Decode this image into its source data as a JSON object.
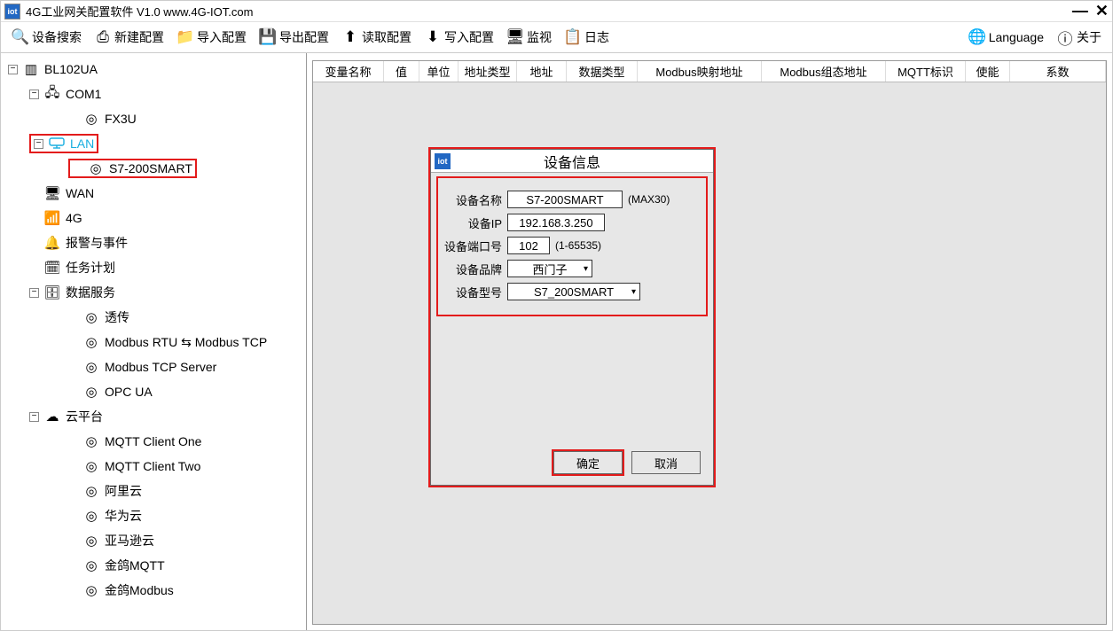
{
  "window": {
    "title": "4G工业网关配置软件 V1.0 www.4G-IOT.com"
  },
  "toolbar": {
    "search": "设备搜索",
    "new": "新建配置",
    "import": "导入配置",
    "export": "导出配置",
    "read": "读取配置",
    "write": "写入配置",
    "monitor": "监视",
    "log": "日志",
    "language": "Language",
    "about": "关于"
  },
  "tree": {
    "root": "BL102UA",
    "com1": "COM1",
    "fx3u": "FX3U",
    "lan": "LAN",
    "s7": "S7-200SMART",
    "wan": "WAN",
    "g4": "4G",
    "alarm": "报警与事件",
    "task": "任务计划",
    "dataservice": "数据服务",
    "passthrough": "透传",
    "mrtu": "Modbus RTU ⇆ Modbus TCP",
    "mtcp": "Modbus TCP Server",
    "opc": "OPC UA",
    "cloud": "云平台",
    "mqtt1": "MQTT Client One",
    "mqtt2": "MQTT Client Two",
    "ali": "阿里云",
    "huawei": "华为云",
    "aws": "亚马逊云",
    "jinge": "金鸽MQTT",
    "jingeMb": "金鸽Modbus"
  },
  "columns": {
    "c1": "变量名称",
    "c2": "值",
    "c3": "单位",
    "c4": "地址类型",
    "c5": "地址",
    "c6": "数据类型",
    "c7": "Modbus映射地址",
    "c8": "Modbus组态地址",
    "c9": "MQTT标识",
    "c10": "使能",
    "c11": "系数"
  },
  "dialog": {
    "title": "设备信息",
    "name_lbl": "设备名称",
    "name_val": "S7-200SMART",
    "name_hint": "(MAX30)",
    "ip_lbl": "设备IP",
    "ip_val": "192.168.3.250",
    "port_lbl": "设备端口号",
    "port_val": "102",
    "port_hint": "(1-65535)",
    "brand_lbl": "设备品牌",
    "brand_val": "西门子",
    "model_lbl": "设备型号",
    "model_val": "S7_200SMART",
    "ok": "确定",
    "cancel": "取消"
  }
}
